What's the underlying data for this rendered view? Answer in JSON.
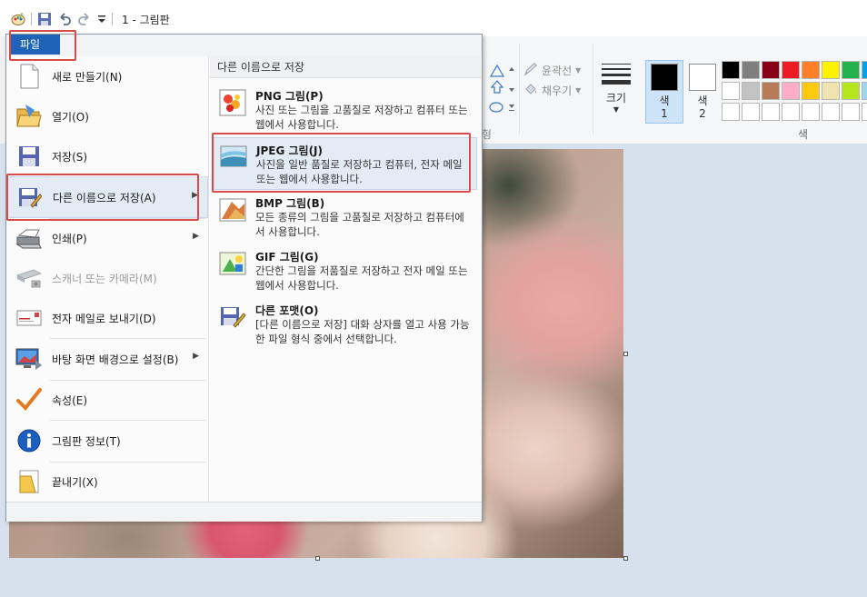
{
  "window": {
    "title": "1 - 그림판"
  },
  "menu": {
    "file_tab": "파일",
    "items": [
      {
        "label": "새로 만들기(N)",
        "icon": "new-document-icon"
      },
      {
        "label": "열기(O)",
        "icon": "open-folder-icon"
      },
      {
        "label": "저장(S)",
        "icon": "save-disk-icon"
      },
      {
        "label": "다른 이름으로 저장(A)",
        "icon": "save-as-icon",
        "submenu": true
      },
      {
        "label": "인쇄(P)",
        "icon": "printer-icon",
        "submenu": true
      },
      {
        "label": "스캐너 또는 카메라(M)",
        "icon": "scanner-icon",
        "disabled": true
      },
      {
        "label": "전자 메일로 보내기(D)",
        "icon": "email-icon"
      },
      {
        "label": "바탕 화면 배경으로 설정(B)",
        "icon": "desktop-background-icon",
        "submenu": true
      },
      {
        "label": "속성(E)",
        "icon": "properties-check-icon"
      },
      {
        "label": "그림판 정보(T)",
        "icon": "info-icon"
      },
      {
        "label": "끝내기(X)",
        "icon": "exit-icon"
      }
    ],
    "save_as": {
      "header": "다른 이름으로 저장",
      "options": [
        {
          "title": "PNG 그림(P)",
          "desc": "사진 또는 그림을 고품질로 저장하고 컴퓨터 또는 웹에서 사용합니다.",
          "icon": "png-image-icon"
        },
        {
          "title": "JPEG 그림(J)",
          "desc": "사진을 일반 품질로 저장하고 컴퓨터, 전자 메일 또는 웹에서 사용합니다.",
          "icon": "jpeg-image-icon"
        },
        {
          "title": "BMP 그림(B)",
          "desc": "모든 종류의 그림을 고품질로 저장하고 컴퓨터에서 사용합니다.",
          "icon": "bmp-image-icon"
        },
        {
          "title": "GIF 그림(G)",
          "desc": "간단한 그림을 저품질로 저장하고 전자 메일 또는 웹에서 사용합니다.",
          "icon": "gif-image-icon"
        },
        {
          "title": "다른 포맷(O)",
          "desc": "[다른 이름으로 저장] 대화 상자를 열고 사용 가능한 파일 형식 중에서 선택합니다.",
          "icon": "other-format-icon"
        }
      ]
    }
  },
  "ribbon": {
    "outline": "윤곽선",
    "fill": "채우기",
    "size": "크기",
    "color1": "색\n1",
    "color2": "색\n2",
    "colors_group": "색",
    "shapes_group_fragment": "형",
    "palette_row1": [
      "#000000",
      "#7f7f7f",
      "#880015",
      "#ed1c24",
      "#ff7f27",
      "#fff200",
      "#22b14c",
      "#00a2e8"
    ],
    "palette_row2": [
      "#ffffff",
      "#c3c3c3",
      "#b97a57",
      "#ffaec9",
      "#ffc90e",
      "#efe4b0",
      "#b5e61d",
      "#99d9ea"
    ],
    "palette_row3": [
      "#ffffff",
      "#ffffff",
      "#ffffff",
      "#ffffff",
      "#ffffff",
      "#ffffff",
      "#ffffff",
      "#ffffff"
    ]
  }
}
